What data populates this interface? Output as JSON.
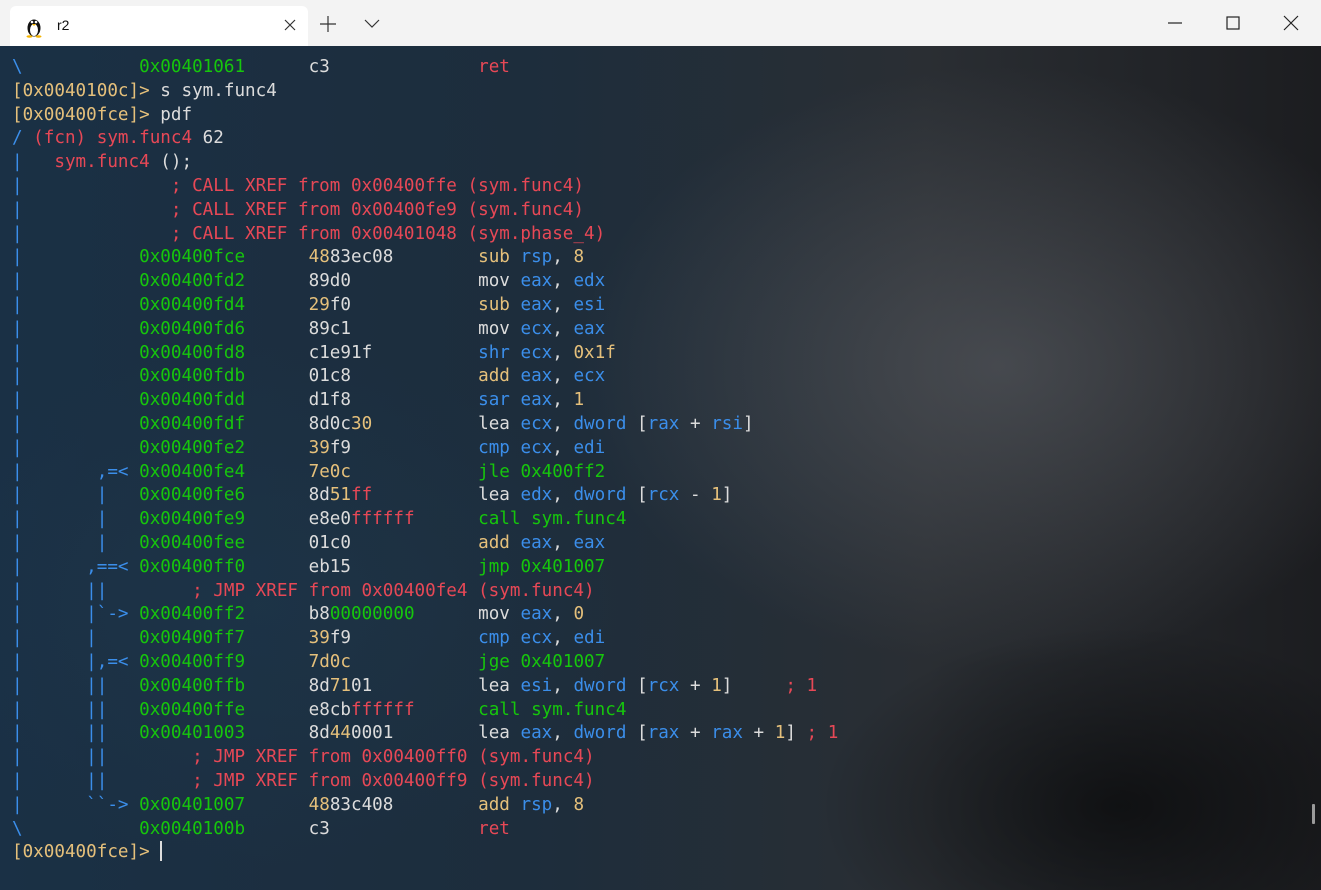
{
  "window": {
    "tab_title": "r2",
    "icon": "linux-penguin-icon",
    "controls": [
      "minimize-icon",
      "maximize-icon",
      "close-icon"
    ]
  },
  "colors": {
    "blue": "#3b8eea",
    "green": "#16c60c",
    "red": "#e74856",
    "yellow": "#e5c07b",
    "white": "#dcdcdc",
    "darkred": "#c50f1f"
  },
  "terminal": {
    "lines": [
      [
        [
          "\\",
          "b"
        ],
        [
          "           ",
          "w"
        ],
        [
          "0x00401061",
          "g"
        ],
        [
          "      ",
          "w"
        ],
        [
          "c3",
          "w"
        ],
        [
          "              ",
          "w"
        ],
        [
          "ret",
          "r"
        ]
      ],
      [
        [
          "[0x0040100c]>",
          "y"
        ],
        [
          " s sym.func4",
          "w"
        ]
      ],
      [
        [
          "[0x00400fce]>",
          "y"
        ],
        [
          " pdf",
          "w"
        ]
      ],
      [
        [
          "/",
          "b"
        ],
        [
          " (fcn) sym.func4",
          "r"
        ],
        [
          " 62",
          "w"
        ]
      ],
      [
        [
          "|",
          "b"
        ],
        [
          "   ",
          "w"
        ],
        [
          "sym.func4",
          "r"
        ],
        [
          " ();",
          "w"
        ]
      ],
      [
        [
          "|",
          "b"
        ],
        [
          "              ; CALL XREF from 0x00400ffe (sym.func4)",
          "r"
        ]
      ],
      [
        [
          "|",
          "b"
        ],
        [
          "              ; CALL XREF from 0x00400fe9 (sym.func4)",
          "r"
        ]
      ],
      [
        [
          "|",
          "b"
        ],
        [
          "              ; CALL XREF from 0x00401048 (sym.phase_4)",
          "r"
        ]
      ],
      [
        [
          "|",
          "b"
        ],
        [
          "           ",
          "w"
        ],
        [
          "0x00400fce",
          "g"
        ],
        [
          "      ",
          "w"
        ],
        [
          "48",
          "y"
        ],
        [
          "83ec08",
          "w"
        ],
        [
          "        ",
          "w"
        ],
        [
          "sub",
          "y"
        ],
        [
          " ",
          "w"
        ],
        [
          "rsp",
          "b"
        ],
        [
          ", ",
          "w"
        ],
        [
          "8",
          "y"
        ]
      ],
      [
        [
          "|",
          "b"
        ],
        [
          "           ",
          "w"
        ],
        [
          "0x00400fd2",
          "g"
        ],
        [
          "      ",
          "w"
        ],
        [
          "89d0",
          "w"
        ],
        [
          "            ",
          "w"
        ],
        [
          "mov",
          "w"
        ],
        [
          " ",
          "w"
        ],
        [
          "eax",
          "b"
        ],
        [
          ", ",
          "w"
        ],
        [
          "edx",
          "b"
        ]
      ],
      [
        [
          "|",
          "b"
        ],
        [
          "           ",
          "w"
        ],
        [
          "0x00400fd4",
          "g"
        ],
        [
          "      ",
          "w"
        ],
        [
          "29",
          "y"
        ],
        [
          "f0",
          "w"
        ],
        [
          "            ",
          "w"
        ],
        [
          "sub",
          "y"
        ],
        [
          " ",
          "w"
        ],
        [
          "eax",
          "b"
        ],
        [
          ", ",
          "w"
        ],
        [
          "esi",
          "b"
        ]
      ],
      [
        [
          "|",
          "b"
        ],
        [
          "           ",
          "w"
        ],
        [
          "0x00400fd6",
          "g"
        ],
        [
          "      ",
          "w"
        ],
        [
          "89c1",
          "w"
        ],
        [
          "            ",
          "w"
        ],
        [
          "mov",
          "w"
        ],
        [
          " ",
          "w"
        ],
        [
          "ecx",
          "b"
        ],
        [
          ", ",
          "w"
        ],
        [
          "eax",
          "b"
        ]
      ],
      [
        [
          "|",
          "b"
        ],
        [
          "           ",
          "w"
        ],
        [
          "0x00400fd8",
          "g"
        ],
        [
          "      ",
          "w"
        ],
        [
          "c1e91f",
          "w"
        ],
        [
          "          ",
          "w"
        ],
        [
          "shr",
          "b"
        ],
        [
          " ",
          "w"
        ],
        [
          "ecx",
          "b"
        ],
        [
          ", ",
          "w"
        ],
        [
          "0x1f",
          "y"
        ]
      ],
      [
        [
          "|",
          "b"
        ],
        [
          "           ",
          "w"
        ],
        [
          "0x00400fdb",
          "g"
        ],
        [
          "      ",
          "w"
        ],
        [
          "01c8",
          "w"
        ],
        [
          "            ",
          "w"
        ],
        [
          "add",
          "y"
        ],
        [
          " ",
          "w"
        ],
        [
          "eax",
          "b"
        ],
        [
          ", ",
          "w"
        ],
        [
          "ecx",
          "b"
        ]
      ],
      [
        [
          "|",
          "b"
        ],
        [
          "           ",
          "w"
        ],
        [
          "0x00400fdd",
          "g"
        ],
        [
          "      ",
          "w"
        ],
        [
          "d1f8",
          "w"
        ],
        [
          "            ",
          "w"
        ],
        [
          "sar",
          "b"
        ],
        [
          " ",
          "w"
        ],
        [
          "eax",
          "b"
        ],
        [
          ", ",
          "w"
        ],
        [
          "1",
          "y"
        ]
      ],
      [
        [
          "|",
          "b"
        ],
        [
          "           ",
          "w"
        ],
        [
          "0x00400fdf",
          "g"
        ],
        [
          "      ",
          "w"
        ],
        [
          "8d0c",
          "w"
        ],
        [
          "30",
          "y"
        ],
        [
          "          ",
          "w"
        ],
        [
          "lea",
          "w"
        ],
        [
          " ",
          "w"
        ],
        [
          "ecx",
          "b"
        ],
        [
          ", ",
          "w"
        ],
        [
          "dword",
          "b"
        ],
        [
          " [",
          "w"
        ],
        [
          "rax",
          "b"
        ],
        [
          " + ",
          "w"
        ],
        [
          "rsi",
          "b"
        ],
        [
          "]",
          "w"
        ]
      ],
      [
        [
          "|",
          "b"
        ],
        [
          "           ",
          "w"
        ],
        [
          "0x00400fe2",
          "g"
        ],
        [
          "      ",
          "w"
        ],
        [
          "39",
          "y"
        ],
        [
          "f9",
          "w"
        ],
        [
          "            ",
          "w"
        ],
        [
          "cmp",
          "b"
        ],
        [
          " ",
          "w"
        ],
        [
          "ecx",
          "b"
        ],
        [
          ", ",
          "w"
        ],
        [
          "edi",
          "b"
        ]
      ],
      [
        [
          "|",
          "b"
        ],
        [
          "       ,=< ",
          "b"
        ],
        [
          "0x00400fe4",
          "g"
        ],
        [
          "      ",
          "w"
        ],
        [
          "7e0c",
          "y"
        ],
        [
          "            ",
          "w"
        ],
        [
          "jle",
          "g"
        ],
        [
          " 0x400ff2",
          "g"
        ]
      ],
      [
        [
          "|",
          "b"
        ],
        [
          "       |   ",
          "b"
        ],
        [
          "0x00400fe6",
          "g"
        ],
        [
          "      ",
          "w"
        ],
        [
          "8d",
          "w"
        ],
        [
          "51",
          "y"
        ],
        [
          "ff",
          "r"
        ],
        [
          "          ",
          "w"
        ],
        [
          "lea",
          "w"
        ],
        [
          " ",
          "w"
        ],
        [
          "edx",
          "b"
        ],
        [
          ", ",
          "w"
        ],
        [
          "dword",
          "b"
        ],
        [
          " [",
          "w"
        ],
        [
          "rcx",
          "b"
        ],
        [
          " - ",
          "w"
        ],
        [
          "1",
          "y"
        ],
        [
          "]",
          "w"
        ]
      ],
      [
        [
          "|",
          "b"
        ],
        [
          "       |   ",
          "b"
        ],
        [
          "0x00400fe9",
          "g"
        ],
        [
          "      ",
          "w"
        ],
        [
          "e8e0",
          "w"
        ],
        [
          "ffffff",
          "r"
        ],
        [
          "      ",
          "w"
        ],
        [
          "call sym.func4",
          "g"
        ]
      ],
      [
        [
          "|",
          "b"
        ],
        [
          "       |   ",
          "b"
        ],
        [
          "0x00400fee",
          "g"
        ],
        [
          "      ",
          "w"
        ],
        [
          "01c0",
          "w"
        ],
        [
          "            ",
          "w"
        ],
        [
          "add",
          "y"
        ],
        [
          " ",
          "w"
        ],
        [
          "eax",
          "b"
        ],
        [
          ", ",
          "w"
        ],
        [
          "eax",
          "b"
        ]
      ],
      [
        [
          "|",
          "b"
        ],
        [
          "      ,==< ",
          "b"
        ],
        [
          "0x00400ff0",
          "g"
        ],
        [
          "      ",
          "w"
        ],
        [
          "eb15",
          "w"
        ],
        [
          "            ",
          "w"
        ],
        [
          "jmp",
          "g"
        ],
        [
          " 0x401007",
          "g"
        ]
      ],
      [
        [
          "|",
          "b"
        ],
        [
          "      ||",
          "b"
        ],
        [
          "        ; JMP XREF from 0x00400fe4 (sym.func4)",
          "r"
        ]
      ],
      [
        [
          "|",
          "b"
        ],
        [
          "      |`-> ",
          "b"
        ],
        [
          "0x00400ff2",
          "g"
        ],
        [
          "      ",
          "w"
        ],
        [
          "b8",
          "w"
        ],
        [
          "00000000",
          "g"
        ],
        [
          "      ",
          "w"
        ],
        [
          "mov",
          "w"
        ],
        [
          " ",
          "w"
        ],
        [
          "eax",
          "b"
        ],
        [
          ", ",
          "w"
        ],
        [
          "0",
          "y"
        ]
      ],
      [
        [
          "|",
          "b"
        ],
        [
          "      |    ",
          "b"
        ],
        [
          "0x00400ff7",
          "g"
        ],
        [
          "      ",
          "w"
        ],
        [
          "39",
          "y"
        ],
        [
          "f9",
          "w"
        ],
        [
          "            ",
          "w"
        ],
        [
          "cmp",
          "b"
        ],
        [
          " ",
          "w"
        ],
        [
          "ecx",
          "b"
        ],
        [
          ", ",
          "w"
        ],
        [
          "edi",
          "b"
        ]
      ],
      [
        [
          "|",
          "b"
        ],
        [
          "      |,=< ",
          "b"
        ],
        [
          "0x00400ff9",
          "g"
        ],
        [
          "      ",
          "w"
        ],
        [
          "7d0c",
          "y"
        ],
        [
          "            ",
          "w"
        ],
        [
          "jge",
          "g"
        ],
        [
          " 0x401007",
          "g"
        ]
      ],
      [
        [
          "|",
          "b"
        ],
        [
          "      ||   ",
          "b"
        ],
        [
          "0x00400ffb",
          "g"
        ],
        [
          "      ",
          "w"
        ],
        [
          "8d",
          "w"
        ],
        [
          "71",
          "y"
        ],
        [
          "01",
          "w"
        ],
        [
          "          ",
          "w"
        ],
        [
          "lea",
          "w"
        ],
        [
          " ",
          "w"
        ],
        [
          "esi",
          "b"
        ],
        [
          ", ",
          "w"
        ],
        [
          "dword",
          "b"
        ],
        [
          " [",
          "w"
        ],
        [
          "rcx",
          "b"
        ],
        [
          " + ",
          "w"
        ],
        [
          "1",
          "y"
        ],
        [
          "]",
          "w"
        ],
        [
          "     ; 1",
          "r"
        ]
      ],
      [
        [
          "|",
          "b"
        ],
        [
          "      ||   ",
          "b"
        ],
        [
          "0x00400ffe",
          "g"
        ],
        [
          "      ",
          "w"
        ],
        [
          "e8cb",
          "w"
        ],
        [
          "ffffff",
          "r"
        ],
        [
          "      ",
          "w"
        ],
        [
          "call sym.func4",
          "g"
        ]
      ],
      [
        [
          "|",
          "b"
        ],
        [
          "      ||   ",
          "b"
        ],
        [
          "0x00401003",
          "g"
        ],
        [
          "      ",
          "w"
        ],
        [
          "8d",
          "w"
        ],
        [
          "44",
          "y"
        ],
        [
          "0001",
          "w"
        ],
        [
          "        ",
          "w"
        ],
        [
          "lea",
          "w"
        ],
        [
          " ",
          "w"
        ],
        [
          "eax",
          "b"
        ],
        [
          ", ",
          "w"
        ],
        [
          "dword",
          "b"
        ],
        [
          " [",
          "w"
        ],
        [
          "rax",
          "b"
        ],
        [
          " + ",
          "w"
        ],
        [
          "rax",
          "b"
        ],
        [
          " + ",
          "w"
        ],
        [
          "1",
          "y"
        ],
        [
          "]",
          "w"
        ],
        [
          " ; 1",
          "r"
        ]
      ],
      [
        [
          "|",
          "b"
        ],
        [
          "      ||",
          "b"
        ],
        [
          "        ; JMP XREF from 0x00400ff0 (sym.func4)",
          "r"
        ]
      ],
      [
        [
          "|",
          "b"
        ],
        [
          "      ||",
          "b"
        ],
        [
          "        ; JMP XREF from 0x00400ff9 (sym.func4)",
          "r"
        ]
      ],
      [
        [
          "|",
          "b"
        ],
        [
          "      ``-> ",
          "b"
        ],
        [
          "0x00401007",
          "g"
        ],
        [
          "      ",
          "w"
        ],
        [
          "48",
          "y"
        ],
        [
          "83c408",
          "w"
        ],
        [
          "        ",
          "w"
        ],
        [
          "add",
          "y"
        ],
        [
          " ",
          "w"
        ],
        [
          "rsp",
          "b"
        ],
        [
          ", ",
          "w"
        ],
        [
          "8",
          "y"
        ]
      ],
      [
        [
          "\\",
          "b"
        ],
        [
          "           ",
          "w"
        ],
        [
          "0x0040100b",
          "g"
        ],
        [
          "      ",
          "w"
        ],
        [
          "c3",
          "w"
        ],
        [
          "              ",
          "w"
        ],
        [
          "ret",
          "r"
        ]
      ],
      [
        [
          "[0x00400fce]>",
          "y"
        ],
        [
          " ",
          "w"
        ]
      ]
    ]
  }
}
